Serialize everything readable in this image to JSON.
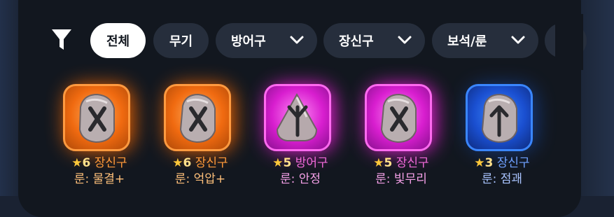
{
  "filter_bar": {
    "icon": "filter-icon",
    "chips": [
      {
        "label": "전체",
        "active": true
      },
      {
        "label": "무기",
        "active": false
      },
      {
        "label": "방어구",
        "dropdown": true
      },
      {
        "label": "장신구",
        "dropdown": true
      },
      {
        "label": "보석/룬",
        "dropdown": true
      }
    ]
  },
  "items": [
    {
      "star_value": "6",
      "category": "장신구",
      "rune": "룬: 물결+",
      "rarity_color": "#ff7a1a",
      "rune_glyph": "X"
    },
    {
      "star_value": "6",
      "category": "장신구",
      "rune": "룬: 억압+",
      "rarity_color": "#ff7a1a",
      "rune_glyph": "X"
    },
    {
      "star_value": "5",
      "category": "방어구",
      "rune": "룬: 안정",
      "rarity_color": "#ee2ee6",
      "rune_glyph": "algiz"
    },
    {
      "star_value": "5",
      "category": "장신구",
      "rune": "룬: 빛무리",
      "rarity_color": "#ee2ee6",
      "rune_glyph": "X"
    },
    {
      "star_value": "3",
      "category": "장신구",
      "rune": "룬: 점괘",
      "rarity_color": "#2a6ee8",
      "rune_glyph": "arrow"
    }
  ],
  "colors": {
    "category_orange": "#ff9a3a",
    "category_pink": "#f06ad8",
    "category_blue": "#6fa0ff",
    "rune_text_orange": "#ffc07a",
    "rune_text_pink": "#f5a0e8",
    "rune_text_blue": "#a9c4ff"
  }
}
